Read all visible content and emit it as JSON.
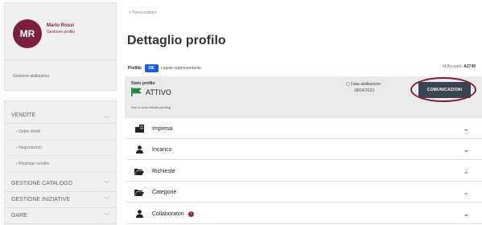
{
  "user": {
    "initials": "MR",
    "name": "Mario Rossi",
    "subtitle": "Gestione profilo",
    "manage_link": "Gestione abilitazioni"
  },
  "menu": {
    "sections": [
      {
        "label": "VENDITE",
        "expanded": true
      },
      {
        "label": "GESTIONE CATALOGO",
        "expanded": false
      },
      {
        "label": "GESTIONE INIZIATIVE",
        "expanded": false
      },
      {
        "label": "GARE",
        "expanded": false
      }
    ],
    "vendite_items": [
      "Ordini diretti",
      "Negoziazioni",
      "Riepilogo vendite"
    ]
  },
  "breadcrumb": "< Torna indietro",
  "page_title": "Dettaglio profilo",
  "profile": {
    "label": "Profilo:",
    "badge": "OE",
    "description": "Legale rappresentante",
    "id_label": "Id Account:",
    "id_value": "A2745"
  },
  "status": {
    "label": "Stato profilo",
    "value": "ATTIVO",
    "note": "Non ci sono attività pending",
    "date_label": "Data abilitazione",
    "date_value": "28/04/2023",
    "button": "COMUNICAZIONI"
  },
  "sections": [
    {
      "label": "Impresa",
      "icon": "building-icon"
    },
    {
      "label": "Incarico",
      "icon": "person-icon"
    },
    {
      "label": "Richieste",
      "icon": "folder-open-icon"
    },
    {
      "label": "Categorie",
      "icon": "folder-open-icon"
    },
    {
      "label": "Collaboratori",
      "icon": "person-icon",
      "info_badge": "i"
    }
  ],
  "colors": {
    "brand": "#7a1f3d",
    "badge_blue": "#1f5bd8",
    "status_green": "#1b8a3a",
    "button_dark": "#3b4552"
  }
}
